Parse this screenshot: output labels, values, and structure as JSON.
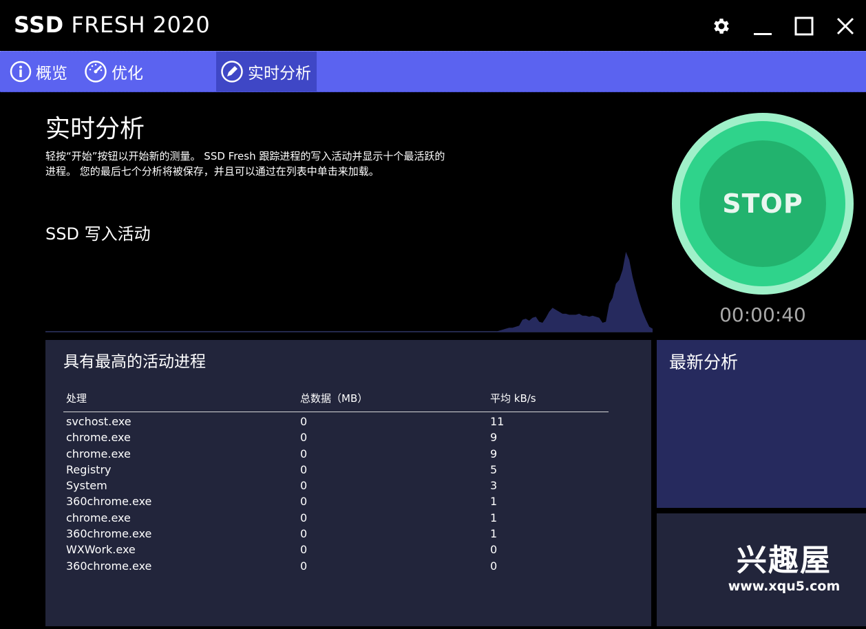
{
  "app": {
    "title_bold": "SSD",
    "title_rest": " FRESH 2020"
  },
  "window_controls": [
    "settings",
    "minimize",
    "maximize",
    "close"
  ],
  "nav": {
    "tabs": [
      {
        "label": "概览",
        "icon": "info-icon"
      },
      {
        "label": "优化",
        "icon": "speedometer-icon"
      },
      {
        "label": "实时分析",
        "icon": "pencil-icon",
        "active": true
      }
    ]
  },
  "main": {
    "title": "实时分析",
    "description_line1": "轻按“开始”按钮以开始新的测量。 SSD Fresh 跟踪进程的写入活动并显示十个最活跃的",
    "description_line2": "进程。 您的最后七个分析将被保存，并且可以通过在列表中单击来加载。",
    "activity_title": "SSD 写入活动"
  },
  "stop_button": {
    "label": "STOP",
    "timer": "00:00:40"
  },
  "processes": {
    "title": "具有最高的活动进程",
    "headers": [
      "处理",
      "总数据（MB）",
      "平均 kB/s"
    ],
    "rows": [
      [
        "svchost.exe",
        "0",
        "11"
      ],
      [
        "chrome.exe",
        "0",
        "9"
      ],
      [
        "chrome.exe",
        "0",
        "9"
      ],
      [
        "Registry",
        "0",
        "5"
      ],
      [
        "System",
        "0",
        "3"
      ],
      [
        "360chrome.exe",
        "0",
        "1"
      ],
      [
        "chrome.exe",
        "0",
        "1"
      ],
      [
        "360chrome.exe",
        "0",
        "1"
      ],
      [
        "WXWork.exe",
        "0",
        "0"
      ],
      [
        "360chrome.exe",
        "0",
        "0"
      ]
    ]
  },
  "recent": {
    "title": "最新分析"
  },
  "watermark": {
    "main": "兴趣屋",
    "sub": "www.xqu5.com"
  },
  "colors": {
    "nav_bg": "#5b63f0",
    "nav_active": "#3f47c6",
    "panel_bg": "#22253b",
    "recent_bg": "#262a5e",
    "stop_outer": "#9ff0c9",
    "stop_ring": "#2fd38b",
    "stop_inner": "#22b36e",
    "chart_fill": "#262a5e"
  },
  "chart_data": {
    "type": "area",
    "values": [
      0,
      0,
      0,
      0,
      0,
      0,
      0,
      0,
      0,
      0,
      0,
      0,
      0,
      0,
      0,
      0,
      0,
      0,
      0,
      0,
      0,
      0,
      0,
      0,
      0,
      0,
      0,
      0,
      0,
      0,
      0,
      0,
      0,
      0,
      0,
      0,
      0,
      0,
      0,
      0,
      0,
      0,
      0,
      0,
      0,
      0,
      0,
      0,
      0,
      0,
      0,
      0,
      0,
      0,
      0,
      0,
      0,
      0,
      0,
      0,
      0,
      0,
      0,
      0,
      0,
      0,
      0,
      0,
      0,
      0,
      0,
      0,
      0,
      0,
      0,
      0,
      0,
      0,
      0,
      0,
      0,
      0,
      0,
      0,
      0,
      0,
      0,
      0,
      0,
      0,
      0,
      0,
      0,
      0,
      0,
      0,
      0,
      0,
      0,
      0,
      0,
      0,
      0,
      0,
      0,
      0,
      0,
      0,
      0,
      0,
      0,
      0,
      0,
      0,
      0,
      0,
      0,
      0,
      0,
      0,
      0,
      0,
      0,
      0,
      0,
      0,
      0,
      0,
      0,
      0,
      0,
      0,
      0,
      0,
      0,
      0,
      1,
      2,
      3,
      4,
      4,
      5,
      6,
      12,
      13,
      11,
      14,
      15,
      10,
      9,
      14,
      20,
      24,
      22,
      20,
      18,
      18,
      17,
      17,
      17,
      18,
      16,
      16,
      15,
      16,
      15,
      14,
      9,
      10,
      28,
      34,
      48,
      52,
      62,
      80,
      72,
      55,
      42,
      30,
      20,
      12,
      5,
      3
    ]
  }
}
